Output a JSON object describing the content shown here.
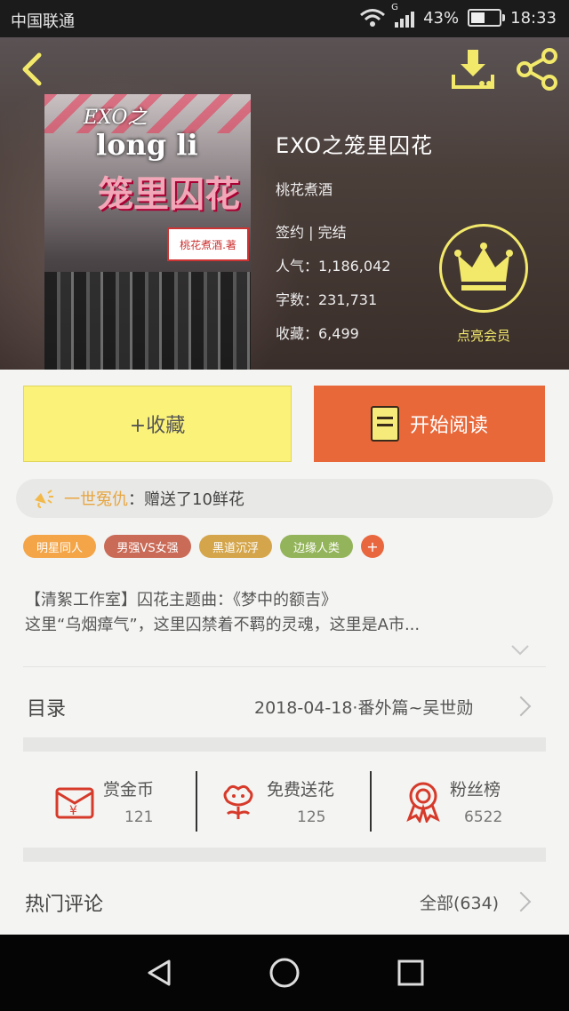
{
  "status_bar": {
    "carrier": "中国联通",
    "signal_type": "G",
    "battery_level": "43%",
    "time": "18:33"
  },
  "book": {
    "title": "EXO之笼里囚花",
    "author": "桃花煮酒",
    "status": "签约 | 完结",
    "popularity": "人气：1,186,042",
    "words": "字数：231,731",
    "collections": "收藏：6,499",
    "cover": {
      "line1": "EXO之",
      "line2": "long li",
      "line3": "笼里囚花",
      "stamp": "桃花煮酒.著"
    }
  },
  "vip": {
    "label": "点亮会员",
    "color": "#f2e96b"
  },
  "actions": {
    "collect": "+收藏",
    "read": "开始阅读"
  },
  "gift_notice": {
    "user": "一世冤仇",
    "message": "：赠送了10鲜花"
  },
  "tags": [
    "明星同人",
    "男强VS女强",
    "黑道沉浮",
    "边缘人类"
  ],
  "tag_add": "+",
  "synopsis": {
    "line1": "【清絮工作室】囚花主题曲：《梦中的额吉》",
    "line2": "这里“乌烟瘴气”，这里囚禁着不羁的灵魂，这里是A市..."
  },
  "toc": {
    "label": "目录",
    "latest": "2018-04-18·番外篇~吴世勋"
  },
  "stats": [
    {
      "label": "赏金币",
      "value": "121",
      "icon": "red-envelope-icon"
    },
    {
      "label": "免费送花",
      "value": "125",
      "icon": "flower-icon"
    },
    {
      "label": "粉丝榜",
      "value": "6522",
      "icon": "ribbon-medal-icon"
    }
  ],
  "comments": {
    "label": "热门评论",
    "all": "全部(634)"
  },
  "colors": {
    "accent_yellow": "#fbf27a",
    "accent_orange": "#e8683a",
    "icon_red": "#d63a2a"
  }
}
